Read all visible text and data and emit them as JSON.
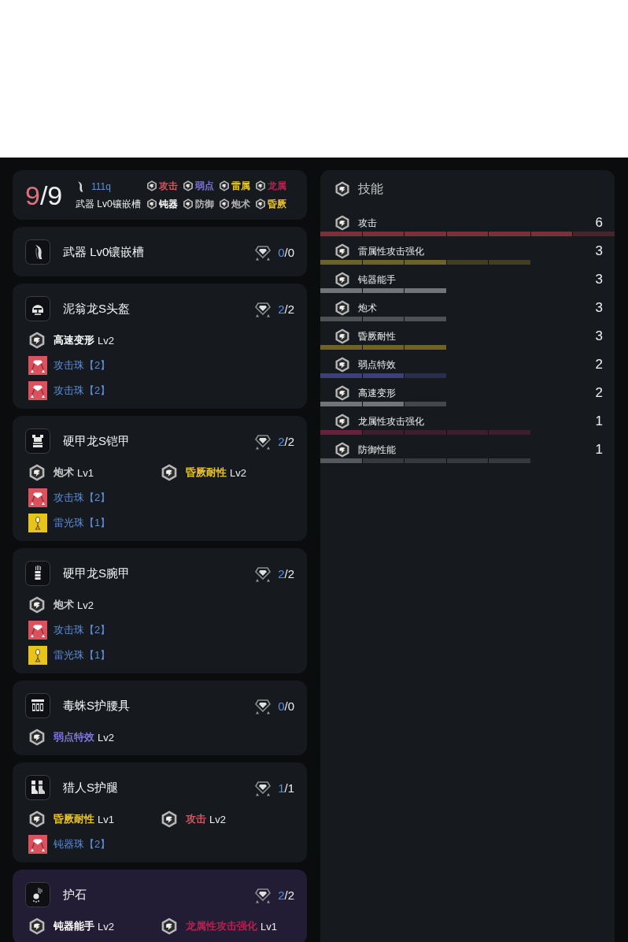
{
  "summary": {
    "used": "9",
    "rest": "/9",
    "weapon_value": "111q",
    "weapon_slots": "武器 Lv0镶嵌槽",
    "tags": [
      {
        "label": "攻击",
        "color": "#d4545e"
      },
      {
        "label": "弱点",
        "color": "#7c74d8"
      },
      {
        "label": "雷属",
        "color": "#e8c22c"
      },
      {
        "label": "龙属",
        "color": "#b4214f"
      },
      {
        "label": "钝器",
        "color": "#ffffff"
      },
      {
        "label": "防御",
        "color": "#b4b4b4"
      },
      {
        "label": "炮术",
        "color": "#b4b4b4"
      },
      {
        "label": "昏厥",
        "color": "#e8c22c"
      }
    ]
  },
  "equipment": [
    {
      "kind": "weapon",
      "name": "武器 Lv0镶嵌槽",
      "slots": {
        "used": "0",
        "rest": "/0"
      }
    },
    {
      "kind": "head",
      "name": "泥翁龙S头盔",
      "slots": {
        "used": "2",
        "rest": "/2"
      },
      "skills": [
        {
          "name": "高速变形",
          "level": "Lv2",
          "color": "#ffffff"
        }
      ],
      "decorations": [
        {
          "name": "攻击珠【2】",
          "kind": "gem",
          "color": "#d9525e"
        },
        {
          "name": "攻击珠【2】",
          "kind": "gem",
          "color": "#d9525e"
        }
      ]
    },
    {
      "kind": "chest",
      "name": "硬甲龙S铠甲",
      "slots": {
        "used": "2",
        "rest": "/2"
      },
      "skills": [
        {
          "name": "炮术",
          "level": "Lv1",
          "color": "#c8c8c8"
        },
        {
          "name": "昏厥耐性",
          "level": "Lv2",
          "color": "#e8c22c"
        }
      ],
      "decorations": [
        {
          "name": "攻击珠【2】",
          "kind": "gem",
          "color": "#d9525e"
        },
        {
          "name": "雷光珠【1】",
          "kind": "drop",
          "color": "#e8c31c"
        }
      ]
    },
    {
      "kind": "arms",
      "name": "硬甲龙S腕甲",
      "slots": {
        "used": "2",
        "rest": "/2"
      },
      "skills": [
        {
          "name": "炮术",
          "level": "Lv2",
          "color": "#c8c8c8"
        }
      ],
      "decorations": [
        {
          "name": "攻击珠【2】",
          "kind": "gem",
          "color": "#d9525e"
        },
        {
          "name": "雷光珠【1】",
          "kind": "drop",
          "color": "#e8c31c"
        }
      ]
    },
    {
      "kind": "waist",
      "name": "毒蛛S护腰具",
      "slots": {
        "used": "0",
        "rest": "/0"
      },
      "skills": [
        {
          "name": "弱点特效",
          "level": "Lv2",
          "color": "#7c74d8"
        }
      ]
    },
    {
      "kind": "legs",
      "name": "猎人S护腿",
      "slots": {
        "used": "1",
        "rest": "/1"
      },
      "skills": [
        {
          "name": "昏厥耐性",
          "level": "Lv1",
          "color": "#e8c22c"
        },
        {
          "name": "攻击",
          "level": "Lv2",
          "color": "#d4545e"
        }
      ],
      "decorations": [
        {
          "name": "钝器珠【2】",
          "kind": "gem",
          "color": "#d9525e"
        }
      ]
    },
    {
      "kind": "charm",
      "name": "护石",
      "slots": {
        "used": "2",
        "rest": "/2"
      },
      "skills": [
        {
          "name": "钝器能手",
          "level": "Lv2",
          "color": "#ffffff"
        },
        {
          "name": "龙属性攻击强化",
          "level": "Lv1",
          "color": "#b4214f"
        }
      ]
    }
  ],
  "skills_panel": {
    "title": "技能",
    "items": [
      {
        "name": "攻击",
        "points": "6",
        "color": "#7a3039",
        "segments": [
          {
            "filled": true
          },
          {
            "filled": true
          },
          {
            "filled": true
          },
          {
            "filled": true
          },
          {
            "filled": true
          },
          {
            "filled": true
          },
          {
            "filled": false
          }
        ]
      },
      {
        "name": "雷属性攻击强化",
        "points": "3",
        "color": "#6e6323",
        "segments": [
          {
            "filled": true
          },
          {
            "filled": true
          },
          {
            "filled": true
          },
          {
            "filled": false
          },
          {
            "filled": false
          }
        ]
      },
      {
        "name": "钝器能手",
        "points": "3",
        "color": "#727478",
        "segments": [
          {
            "filled": true
          },
          {
            "filled": true
          },
          {
            "filled": true
          }
        ]
      },
      {
        "name": "炮术",
        "points": "3",
        "color": "#4e5155",
        "segments": [
          {
            "filled": true
          },
          {
            "filled": true
          },
          {
            "filled": true
          }
        ]
      },
      {
        "name": "昏厥耐性",
        "points": "3",
        "color": "#6e6323",
        "segments": [
          {
            "filled": true
          },
          {
            "filled": true
          },
          {
            "filled": true
          }
        ]
      },
      {
        "name": "弱点特效",
        "points": "2",
        "color": "#3d3f7a",
        "segments": [
          {
            "filled": true
          },
          {
            "filled": true
          },
          {
            "filled": false
          }
        ]
      },
      {
        "name": "高速变形",
        "points": "2",
        "color": "#727478",
        "segments": [
          {
            "filled": true
          },
          {
            "filled": true
          },
          {
            "filled": false
          }
        ]
      },
      {
        "name": "龙属性攻击强化",
        "points": "1",
        "color": "#6c1e3a",
        "segments": [
          {
            "filled": true
          },
          {
            "filled": false
          },
          {
            "filled": false
          },
          {
            "filled": false
          },
          {
            "filled": false
          }
        ]
      },
      {
        "name": "防御性能",
        "points": "1",
        "color": "#55585c",
        "segments": [
          {
            "filled": true
          },
          {
            "filled": false
          },
          {
            "filled": false
          },
          {
            "filled": false
          },
          {
            "filled": false
          }
        ]
      }
    ]
  }
}
